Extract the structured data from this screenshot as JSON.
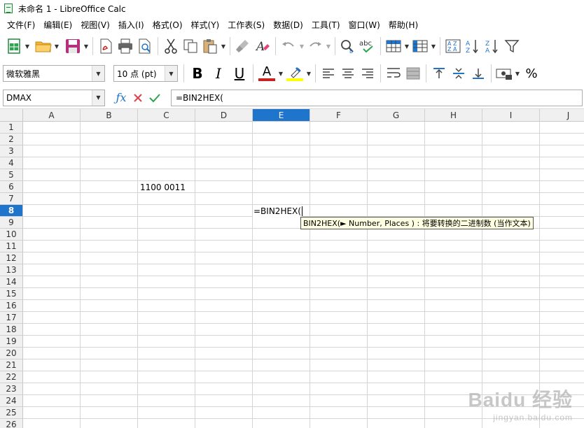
{
  "window": {
    "title": "未命名 1 - LibreOffice Calc"
  },
  "menu": [
    "文件(F)",
    "编辑(E)",
    "视图(V)",
    "插入(I)",
    "格式(O)",
    "样式(Y)",
    "工作表(S)",
    "数据(D)",
    "工具(T)",
    "窗口(W)",
    "帮助(H)"
  ],
  "format_bar": {
    "font_name": "微软雅黑",
    "font_size": "10 点 (pt)",
    "bold": "B",
    "italic": "I",
    "underline": "U",
    "font_color_letter": "A",
    "font_color": "#c9211e",
    "highlight_color": "#ffff00",
    "percent": "%"
  },
  "formula_bar": {
    "name_box": "DMAX",
    "formula": "=BIN2HEX("
  },
  "grid": {
    "columns": [
      "A",
      "B",
      "C",
      "D",
      "E",
      "F",
      "G",
      "H",
      "I",
      "J"
    ],
    "active_column": "E",
    "rows": [
      "1",
      "2",
      "3",
      "4",
      "5",
      "6",
      "7",
      "8",
      "9",
      "10",
      "11",
      "12",
      "13",
      "14",
      "15",
      "16",
      "17",
      "18",
      "19",
      "20",
      "21",
      "22",
      "23",
      "24",
      "25",
      "26"
    ],
    "active_row": "8",
    "cells": {
      "C6": "1100 0011",
      "E8": "=BIN2HEX("
    },
    "tooltip": "BIN2HEX(► Number, Places ) : 将要转换的二进制数 (当作文本)"
  },
  "watermark": {
    "main": "Baidu 经验",
    "sub": "jingyan.baidu.com"
  }
}
